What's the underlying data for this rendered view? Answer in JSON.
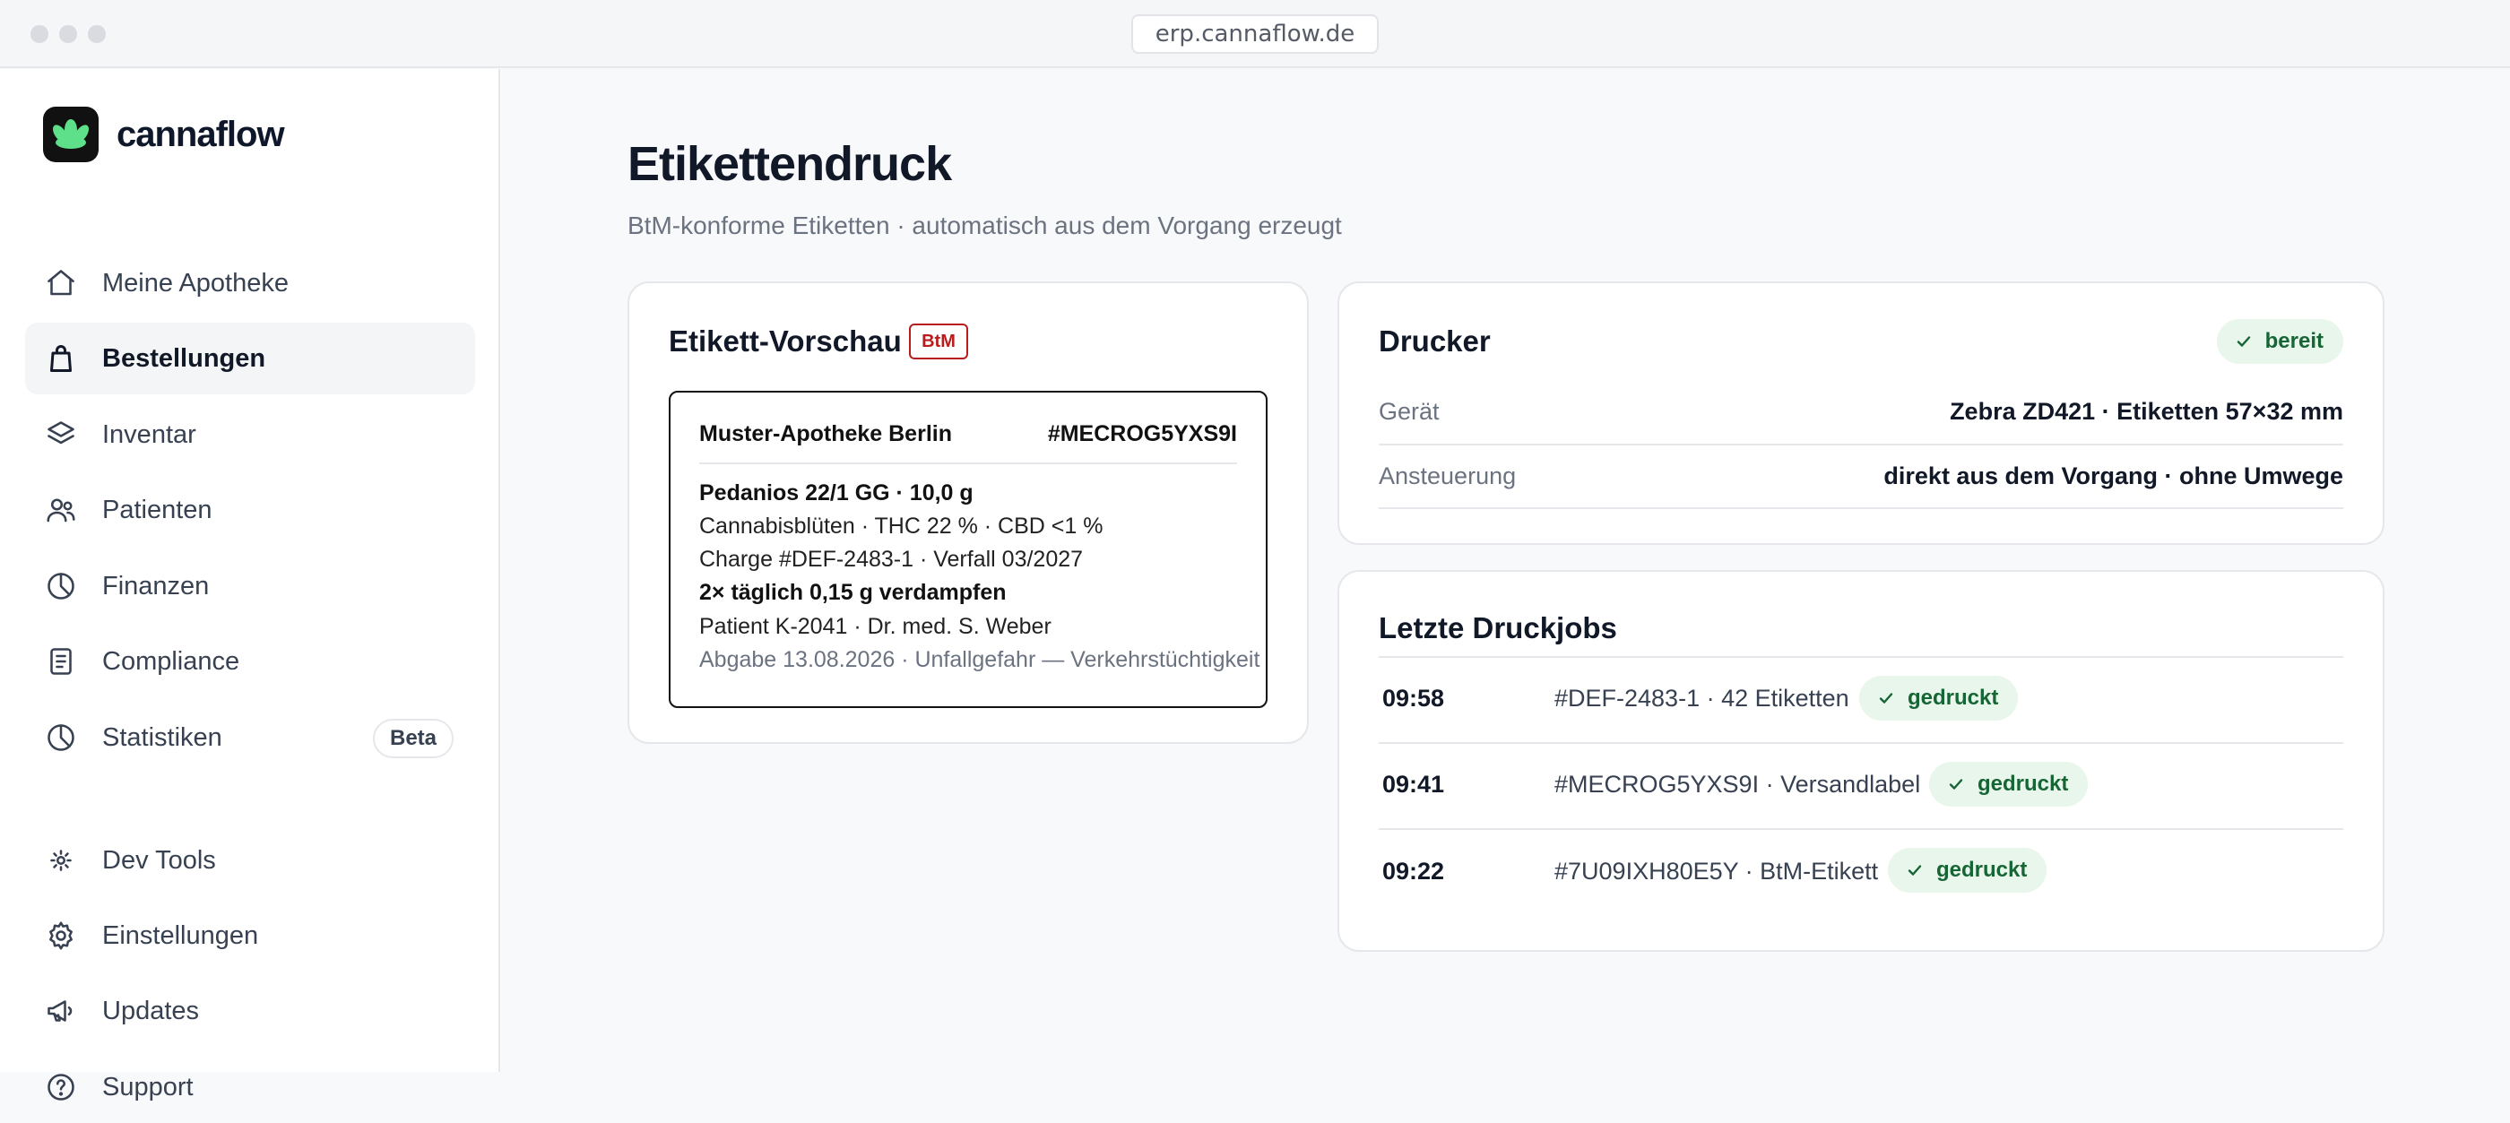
{
  "browser": {
    "url": "erp.cannaflow.de"
  },
  "brand": {
    "name": "cannaflow",
    "logo_icon": "cannabis-leaf-icon",
    "logo_color": "#5ee08a"
  },
  "sidebar": {
    "items": [
      {
        "label": "Meine Apotheke",
        "icon": "home-icon"
      },
      {
        "label": "Bestellungen",
        "icon": "shopping-bag-icon",
        "active": true
      },
      {
        "label": "Inventar",
        "icon": "layers-icon"
      },
      {
        "label": "Patienten",
        "icon": "users-icon"
      },
      {
        "label": "Finanzen",
        "icon": "pie-chart-icon"
      },
      {
        "label": "Compliance",
        "icon": "document-icon"
      },
      {
        "label": "Statistiken",
        "icon": "pie-chart-icon",
        "badge": "Beta"
      }
    ],
    "bottom_items": [
      {
        "label": "Dev Tools",
        "icon": "dev-tools-icon"
      },
      {
        "label": "Einstellungen",
        "icon": "gear-icon"
      },
      {
        "label": "Updates",
        "icon": "megaphone-icon"
      },
      {
        "label": "Support",
        "icon": "help-circle-icon"
      }
    ]
  },
  "page": {
    "title": "Etikettendruck",
    "subtitle": "BtM-konforme Etiketten · automatisch aus dem Vorgang erzeugt"
  },
  "preview": {
    "title": "Etikett-Vorschau",
    "tag": "BtM",
    "tag_color": "#b91c1c",
    "label": {
      "pharmacy": "Muster-Apotheke Berlin",
      "order_id": "#MECROG5YXS9I",
      "product": "Pedanios 22/1 GG · 10,0 g",
      "composition": "Cannabisblüten · THC 22 % · CBD <1 %",
      "batch": "Charge #DEF-2483-1 · Verfall 03/2027",
      "dosage": "2× täglich 0,15 g verdampfen",
      "patient": "Patient K-2041 · Dr. med. S. Weber",
      "dispense": "Abgabe 13.08.2026 · Unfallgefahr — Verkehrstüchtigkeit"
    }
  },
  "printer": {
    "title": "Drucker",
    "status": "bereit",
    "status_color": "#166534",
    "rows": [
      {
        "label": "Gerät",
        "value": "Zebra ZD421 · Etiketten 57×32 mm"
      },
      {
        "label": "Ansteuerung",
        "value": "direkt aus dem Vorgang · ohne Umwege"
      }
    ]
  },
  "jobs": {
    "title": "Letzte Druckjobs",
    "items": [
      {
        "time": "09:58",
        "desc": "#DEF-2483-1 · 42 Etiketten",
        "status": "gedruckt"
      },
      {
        "time": "09:41",
        "desc": "#MECROG5YXS9I · Versandlabel",
        "status": "gedruckt"
      },
      {
        "time": "09:22",
        "desc": "#7U09IXH80E5Y · BtM-Etikett",
        "status": "gedruckt"
      }
    ]
  }
}
